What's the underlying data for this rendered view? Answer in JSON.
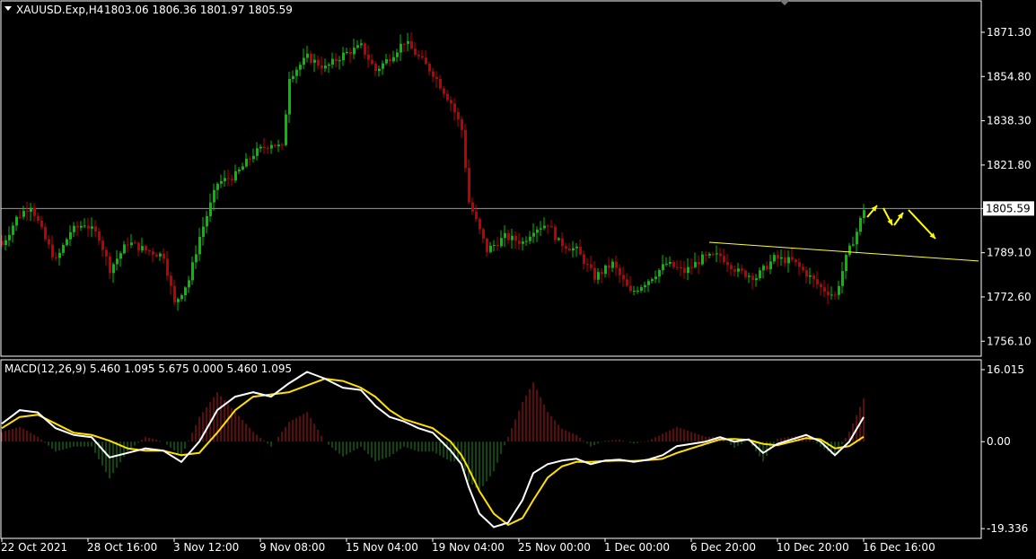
{
  "chart_data": {
    "type": "candlestick",
    "symbol_label": "XAUUSD.Exp,H4",
    "ohlc_label": "1803.06 1806.36 1801.97 1805.59",
    "price": {
      "y_ticks": [
        "1871.30",
        "1854.80",
        "1838.30",
        "1821.80",
        "1805.59",
        "1789.10",
        "1772.60",
        "1756.10"
      ],
      "y_tick_values": [
        1871.3,
        1854.8,
        1838.3,
        1821.8,
        1805.59,
        1789.1,
        1772.6,
        1756.1
      ],
      "ylim": [
        1750.5,
        1883.0
      ],
      "current_price": 1805.59,
      "current_price_label": "1805.59",
      "trendline_start": {
        "bar": 197,
        "price": 1793.0
      },
      "trendline_end": {
        "bar": 272,
        "price": 1786.0
      },
      "anchors": [
        [
          0,
          1792
        ],
        [
          4,
          1802
        ],
        [
          8,
          1807
        ],
        [
          12,
          1794
        ],
        [
          15,
          1786
        ],
        [
          19,
          1797
        ],
        [
          23,
          1800
        ],
        [
          27,
          1795
        ],
        [
          30,
          1783
        ],
        [
          35,
          1793
        ],
        [
          40,
          1790
        ],
        [
          45,
          1788
        ],
        [
          48,
          1770
        ],
        [
          52,
          1779
        ],
        [
          55,
          1795
        ],
        [
          60,
          1815
        ],
        [
          65,
          1818
        ],
        [
          70,
          1826
        ],
        [
          75,
          1830
        ],
        [
          78,
          1828
        ],
        [
          80,
          1855
        ],
        [
          85,
          1862
        ],
        [
          90,
          1858
        ],
        [
          95,
          1863
        ],
        [
          100,
          1866
        ],
        [
          104,
          1857
        ],
        [
          108,
          1862
        ],
        [
          112,
          1868
        ],
        [
          116,
          1862
        ],
        [
          120,
          1856
        ],
        [
          125,
          1845
        ],
        [
          128,
          1835
        ],
        [
          130,
          1808
        ],
        [
          135,
          1790
        ],
        [
          140,
          1795
        ],
        [
          145,
          1793
        ],
        [
          148,
          1798
        ],
        [
          152,
          1800
        ],
        [
          155,
          1793
        ],
        [
          160,
          1790
        ],
        [
          165,
          1780
        ],
        [
          170,
          1785
        ],
        [
          175,
          1774
        ],
        [
          180,
          1779
        ],
        [
          185,
          1785
        ],
        [
          190,
          1782
        ],
        [
          195,
          1787
        ],
        [
          200,
          1788
        ],
        [
          205,
          1782
        ],
        [
          210,
          1780
        ],
        [
          215,
          1787
        ],
        [
          220,
          1786
        ],
        [
          225,
          1780
        ],
        [
          228,
          1776
        ],
        [
          232,
          1773
        ],
        [
          235,
          1787
        ],
        [
          238,
          1797
        ],
        [
          240,
          1805.59
        ]
      ]
    },
    "macd": {
      "label": "MACD(12,26,9) 5.460 1.095 5.675 0.000 5.460 1.095",
      "ylim": [
        -21.5,
        18.2
      ],
      "y_ticks": [
        "16.015",
        "0.00",
        "-19.336"
      ],
      "y_tick_values": [
        16.015,
        0,
        -19.336
      ],
      "macd_anchors": [
        [
          0,
          4
        ],
        [
          5,
          7
        ],
        [
          10,
          6.5
        ],
        [
          15,
          3
        ],
        [
          20,
          1.5
        ],
        [
          25,
          1
        ],
        [
          30,
          -3.5
        ],
        [
          35,
          -2.5
        ],
        [
          40,
          -1.5
        ],
        [
          45,
          -2
        ],
        [
          50,
          -4.5
        ],
        [
          55,
          0
        ],
        [
          60,
          7
        ],
        [
          65,
          10
        ],
        [
          70,
          11
        ],
        [
          75,
          10
        ],
        [
          80,
          13
        ],
        [
          85,
          15.5
        ],
        [
          90,
          14
        ],
        [
          95,
          12
        ],
        [
          100,
          11.5
        ],
        [
          104,
          8
        ],
        [
          108,
          5.5
        ],
        [
          112,
          4.5
        ],
        [
          116,
          3
        ],
        [
          120,
          2
        ],
        [
          125,
          -2
        ],
        [
          128,
          -5
        ],
        [
          130,
          -10
        ],
        [
          133,
          -16
        ],
        [
          137,
          -19
        ],
        [
          141,
          -18
        ],
        [
          145,
          -13
        ],
        [
          148,
          -7
        ],
        [
          152,
          -5
        ],
        [
          156,
          -4.2
        ],
        [
          160,
          -3.8
        ],
        [
          164,
          -5
        ],
        [
          168,
          -4.2
        ],
        [
          172,
          -4
        ],
        [
          176,
          -4.5
        ],
        [
          180,
          -4
        ],
        [
          184,
          -3
        ],
        [
          188,
          -1
        ],
        [
          192,
          -0.5
        ],
        [
          196,
          0
        ],
        [
          200,
          1
        ],
        [
          204,
          0
        ],
        [
          208,
          0.5
        ],
        [
          212,
          -2.5
        ],
        [
          216,
          -0.5
        ],
        [
          220,
          0.5
        ],
        [
          224,
          1.5
        ],
        [
          228,
          0
        ],
        [
          232,
          -3
        ],
        [
          236,
          0
        ],
        [
          240,
          5.46
        ]
      ],
      "signal_anchors": [
        [
          0,
          3
        ],
        [
          5,
          5.5
        ],
        [
          10,
          6
        ],
        [
          15,
          4
        ],
        [
          20,
          2
        ],
        [
          25,
          1.5
        ],
        [
          30,
          0.2
        ],
        [
          35,
          -1.5
        ],
        [
          40,
          -2
        ],
        [
          45,
          -2
        ],
        [
          50,
          -3
        ],
        [
          55,
          -2.5
        ],
        [
          60,
          2
        ],
        [
          65,
          7
        ],
        [
          70,
          10
        ],
        [
          75,
          10.5
        ],
        [
          80,
          11
        ],
        [
          85,
          12.5
        ],
        [
          90,
          14
        ],
        [
          95,
          13.5
        ],
        [
          100,
          12
        ],
        [
          104,
          10
        ],
        [
          108,
          7
        ],
        [
          112,
          5
        ],
        [
          116,
          4
        ],
        [
          120,
          3
        ],
        [
          125,
          0
        ],
        [
          128,
          -3
        ],
        [
          130,
          -6
        ],
        [
          133,
          -11
        ],
        [
          137,
          -16
        ],
        [
          141,
          -18.5
        ],
        [
          145,
          -17
        ],
        [
          148,
          -13
        ],
        [
          152,
          -8
        ],
        [
          156,
          -5.5
        ],
        [
          160,
          -4.5
        ],
        [
          164,
          -4.5
        ],
        [
          168,
          -4.3
        ],
        [
          172,
          -4.2
        ],
        [
          176,
          -4.3
        ],
        [
          180,
          -4.1
        ],
        [
          184,
          -3.8
        ],
        [
          188,
          -2.5
        ],
        [
          192,
          -1.5
        ],
        [
          196,
          -0.5
        ],
        [
          200,
          0.5
        ],
        [
          204,
          0.6
        ],
        [
          208,
          0.4
        ],
        [
          212,
          -0.5
        ],
        [
          216,
          -0.8
        ],
        [
          220,
          0
        ],
        [
          224,
          0.8
        ],
        [
          228,
          0.5
        ],
        [
          232,
          -1.5
        ],
        [
          236,
          -1
        ],
        [
          240,
          1.095
        ]
      ]
    },
    "x_ticks": [
      {
        "label": "22 Oct 2021",
        "bar": 0
      },
      {
        "label": "28 Oct 16:00",
        "bar": 24
      },
      {
        "label": "3 Nov 12:00",
        "bar": 48
      },
      {
        "label": "9 Nov 08:00",
        "bar": 72
      },
      {
        "label": "15 Nov 04:00",
        "bar": 96
      },
      {
        "label": "19 Nov 04:00",
        "bar": 120
      },
      {
        "label": "25 Nov 00:00",
        "bar": 144
      },
      {
        "label": "1 Dec 00:00",
        "bar": 168
      },
      {
        "label": "6 Dec 20:00",
        "bar": 192
      },
      {
        "label": "10 Dec 20:00",
        "bar": 216
      },
      {
        "label": "16 Dec 16:00",
        "bar": 240
      }
    ],
    "annotation_arrows": "yellow zigzag arrows projecting rise then decline"
  },
  "colors": {
    "background": "#000000",
    "bull": "#00c000",
    "bear": "#c00000",
    "macd_line": "#ffffff",
    "signal_line": "#ffe000",
    "hist_pos": "#b81818",
    "hist_neg": "#1e8a1e",
    "grid": "#ffffff",
    "trendline": "#ffff33",
    "arrow": "#ffff00"
  }
}
